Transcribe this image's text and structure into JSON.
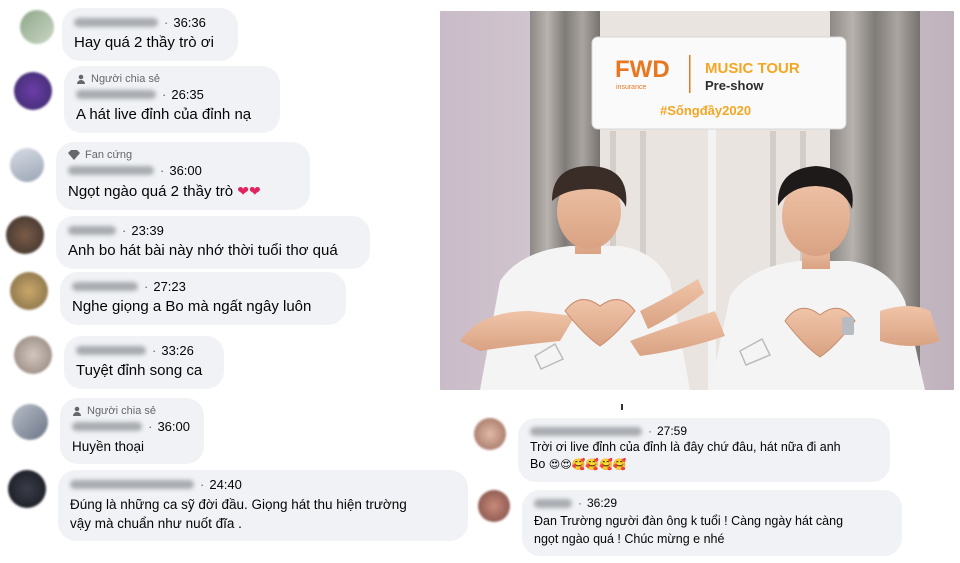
{
  "comments": [
    {
      "badge": "",
      "time": "36:36",
      "text": "Hay quá 2 thầy trò ơi"
    },
    {
      "badge": "Người chia sẻ",
      "time": "26:35",
      "text": "A hát live đỉnh của đỉnh nạ"
    },
    {
      "badge": "Fan cứng",
      "time": "36:00",
      "text": "Ngọt ngào quá 2 thầy trò",
      "emoji": "❤❤"
    },
    {
      "badge": "",
      "time": "23:39",
      "text": "Anh bo hát bài này nhớ thời tuổi thơ quá"
    },
    {
      "badge": "",
      "time": "27:23",
      "text": "Nghe giọng a Bo mà ngất ngây luôn"
    },
    {
      "badge": "",
      "time": "33:26",
      "text": "Tuyệt đỉnh song ca"
    },
    {
      "badge": "Người chia sẻ",
      "time": "36:00",
      "text": "Huyền thoại"
    },
    {
      "badge": "",
      "time": "24:40",
      "text": "Đúng là những ca sỹ đời đầu. Giọng hát thu hiện trường",
      "text2": "vậy mà chuẩn như nuốt đĩa ."
    },
    {
      "badge": "",
      "time": "27:59",
      "text": "Trời ơi live đỉnh của đỉnh là đây chứ đâu, hát nữa đi anh",
      "text2": "Bo",
      "emoji": "😍😍🥰🥰🥰🥰"
    },
    {
      "badge": "",
      "time": "36:29",
      "text": "Đan Trường người đàn ông k tuổi ! Càng ngày hát càng",
      "text2": "ngọt ngào quá ! Chúc mừng e nhé"
    }
  ],
  "photo": {
    "brand": "FWD",
    "brand_sub": "insurance",
    "event_title": "MUSIC TOUR",
    "event_sub": "Pre-show",
    "hashtag": "#Sốngđầy2020"
  },
  "colors": {
    "bubble": "#f0f2f5",
    "meta": "#65676b",
    "brand_orange": "#e87722",
    "event_yellow": "#f5a623",
    "heart": "#e0245e"
  }
}
